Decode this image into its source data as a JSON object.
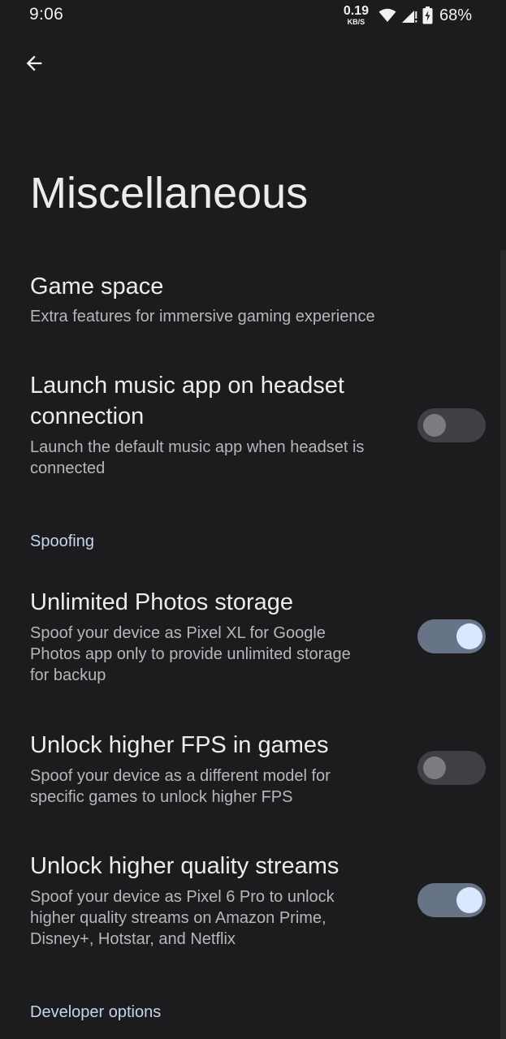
{
  "status_bar": {
    "time": "9:06",
    "speed_value": "0.19",
    "speed_unit": "KB/S",
    "battery_percent": "68%",
    "icons": [
      "wifi-icon",
      "signal-icon",
      "battery-charging-icon"
    ]
  },
  "header": {
    "back_icon": "arrow-back-icon",
    "title": "Miscellaneous"
  },
  "preferences": [
    {
      "title": "Game space",
      "summary": "Extra features for immersive gaming experience"
    },
    {
      "title_lines": [
        "Launch music app on headset",
        "connection"
      ],
      "summary_lines": [
        "Launch the default music app when headset is",
        "connected"
      ],
      "switch_on": false
    }
  ],
  "sections": [
    {
      "header": "Spoofing",
      "items": [
        {
          "title": "Unlimited Photos storage",
          "summary_lines": [
            "Spoof your device as Pixel XL for Google",
            "Photos app only to provide unlimited storage",
            "for backup"
          ],
          "switch_on": true
        },
        {
          "title": "Unlock higher FPS in games",
          "summary_lines": [
            "Spoof your device as a different model for",
            "specific games to unlock higher FPS"
          ],
          "switch_on": false
        },
        {
          "title": "Unlock higher quality streams",
          "summary_lines": [
            "Spoof your device as Pixel 6 Pro to unlock",
            "higher quality streams on Amazon Prime,",
            "Disney+, Hotstar, and Netflix"
          ],
          "switch_on": true
        }
      ]
    },
    {
      "header": "Developer options"
    }
  ],
  "colors": {
    "background": "#1c1c1e",
    "accent_header": "#c3d6ee",
    "switch_on_track": "#677485",
    "switch_on_thumb": "#d9e7ff",
    "switch_off_track": "#404044",
    "switch_off_thumb": "#7c7c80"
  }
}
